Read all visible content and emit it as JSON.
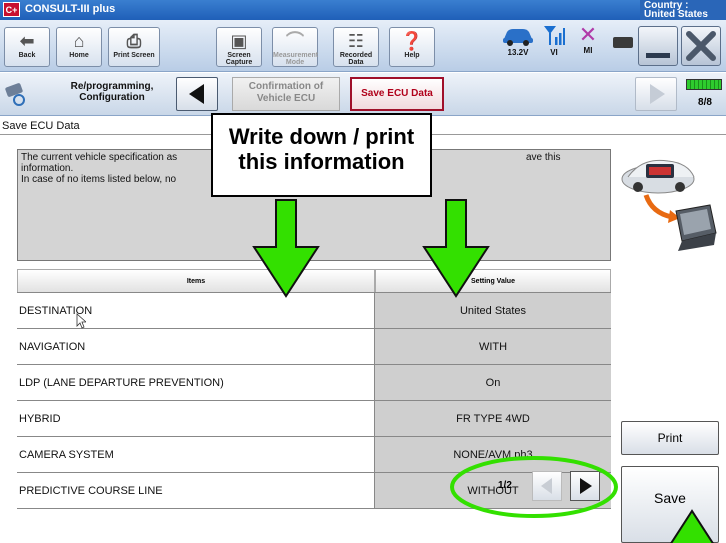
{
  "app": {
    "logo": "C+",
    "title": "CONSULT-III plus",
    "country": "Country : United States"
  },
  "toolbar": {
    "back": "Back",
    "home": "Home",
    "print_screen": "Print Screen",
    "screen_capture": "Screen Capture",
    "measurement_mode": "Measurement Mode",
    "recorded_data": "Recorded Data",
    "help": "Help",
    "voltage": "13.2V",
    "vi": "VI",
    "mi": "MI"
  },
  "breadcrumb": {
    "label": "Re/programming, Configuration",
    "step_prev": "Confirmation of Vehicle ECU",
    "step_current": "Save ECU Data",
    "progress": {
      "current": 8,
      "total": 8,
      "text": "8/8",
      "fraction": 1.0
    }
  },
  "section_title": "Save ECU Data",
  "info": {
    "line1": "The current vehicle specification as",
    "line1_end": "ave this",
    "line2": "information.",
    "line3": "In case of no items listed below, no"
  },
  "table": {
    "headers": [
      "Items",
      "Setting Value"
    ],
    "rows": [
      {
        "item": "DESTINATION",
        "value": "United States"
      },
      {
        "item": "NAVIGATION",
        "value": "WITH"
      },
      {
        "item": "LDP (LANE DEPARTURE PREVENTION)",
        "value": "On"
      },
      {
        "item": "HYBRID",
        "value": "FR TYPE 4WD"
      },
      {
        "item": "CAMERA SYSTEM",
        "value": "NONE/AVM ph3"
      },
      {
        "item": "PREDICTIVE COURSE LINE",
        "value": "WITHOUT"
      }
    ]
  },
  "pager": {
    "text": "1/2"
  },
  "buttons": {
    "print": "Print",
    "save": "Save"
  },
  "callout": {
    "line1": "Write down / print",
    "line2": "this information"
  },
  "colors": {
    "arrow": "#33e000",
    "highlight": "#33e000",
    "accent": "#a0102a"
  }
}
